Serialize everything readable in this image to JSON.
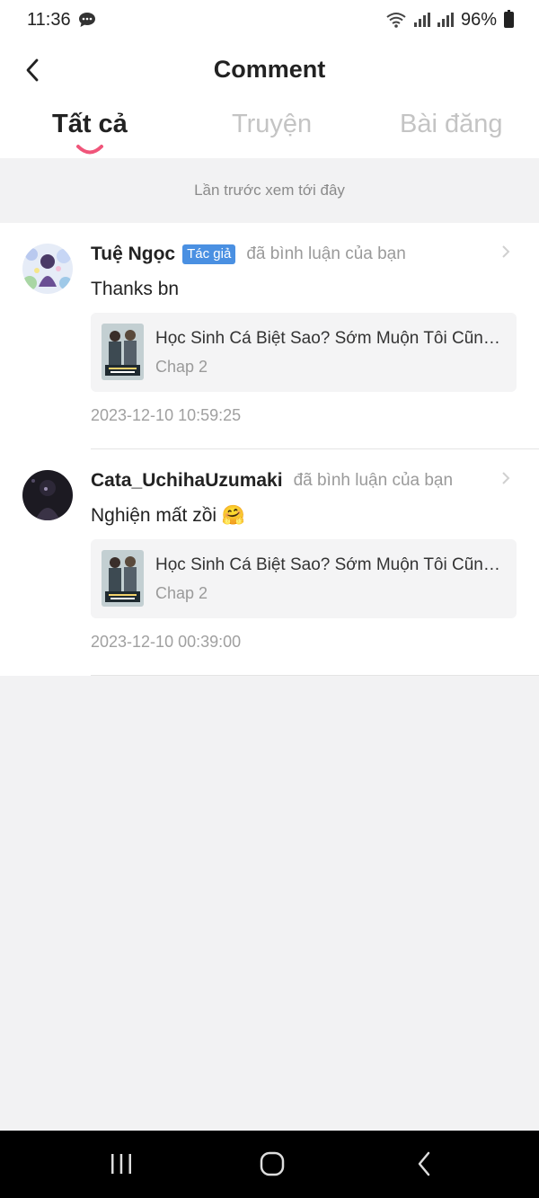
{
  "status": {
    "time": "11:36",
    "battery": "96%"
  },
  "header": {
    "title": "Comment",
    "back_icon": "chevron-left-icon"
  },
  "tabs": [
    {
      "label": "Tất cả",
      "active": true
    },
    {
      "label": "Truyện",
      "active": false
    },
    {
      "label": "Bài đăng",
      "active": false
    }
  ],
  "last_seen_label": "Lần trước xem tới đây",
  "notifications": [
    {
      "username": "Tuệ Ngọc",
      "badge": "Tác giả",
      "action": "đã bình luận của bạn",
      "comment": "Thanks bn",
      "story_title": "Học Sinh Cá Biệt Sao? Sớm Muộn Tôi Cũng T...",
      "chapter": "Chap 2",
      "timestamp": "2023-12-10 10:59:25"
    },
    {
      "username": "Cata_UchihaUzumaki",
      "badge": "",
      "action": "đã bình luận của bạn",
      "comment": "Nghiện mất zồi 🤗",
      "story_title": "Học Sinh Cá Biệt Sao? Sớm Muộn Tôi Cũng T...",
      "chapter": "Chap 2",
      "timestamp": "2023-12-10 00:39:00"
    }
  ],
  "colors": {
    "accent_pink": "#f0557a",
    "badge_blue": "#4a90e2",
    "muted_text": "#9a9a9a",
    "inactive_tab": "#c4c4c4"
  }
}
